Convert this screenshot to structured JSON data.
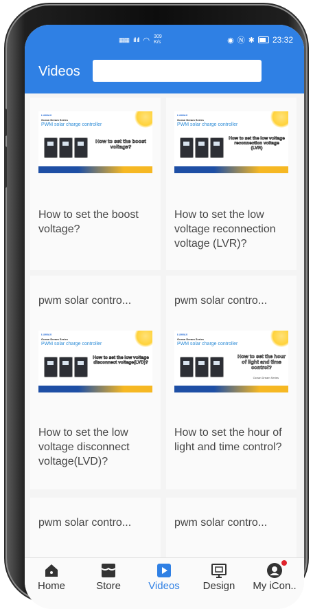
{
  "status_bar": {
    "network_speed": "309",
    "network_unit": "K/s",
    "time": "23:32"
  },
  "header": {
    "title": "Videos",
    "search_placeholder": ""
  },
  "videos": [
    {
      "title": "How to set the boost voltage?",
      "thumb": {
        "brand": "LUMIAX",
        "series": "Ocean Dream Series",
        "product": "PWM solar charge controller",
        "caption": "How to set the boost voltage?"
      }
    },
    {
      "title": "How to set the low voltage reconnection voltage (LVR)?",
      "thumb": {
        "brand": "LUMIAX",
        "series": "Ocean Dream Series",
        "product": "PWM solar charge controller",
        "caption": "How to set the low voltage reconnection voltage (LVR)"
      }
    },
    {
      "title": "How to set the low voltage disconnect voltage(LVD)?",
      "pre_title": "pwm solar contro...",
      "thumb": {
        "brand": "LUMIAX",
        "series": "Ocean Dream Series",
        "product": "PWM solar charge controller",
        "caption": "How to set the low voltage disconnect voltage(LVD)?"
      }
    },
    {
      "title": "How to set the hour of light and time control?",
      "pre_title": "pwm solar contro...",
      "thumb": {
        "brand": "LUMIAX",
        "series": "Ocean Dream Series",
        "product": "PWM solar charge controller",
        "caption": "How to set the hour of light and time control?",
        "footer_series": "Ocean Dream Series"
      }
    },
    {
      "pre_title": "pwm solar contro..."
    },
    {
      "pre_title": "pwm solar contro..."
    }
  ],
  "bottom_nav": [
    {
      "label": "Home",
      "icon": "home-icon",
      "active": false
    },
    {
      "label": "Store",
      "icon": "store-icon",
      "active": false
    },
    {
      "label": "Videos",
      "icon": "play-icon",
      "active": true
    },
    {
      "label": "Design",
      "icon": "design-icon",
      "active": false
    },
    {
      "label": "My iCon..",
      "icon": "person-icon",
      "active": false,
      "badge": true
    }
  ],
  "colors": {
    "brand_blue": "#2f80e4",
    "badge_red": "#e0242c"
  }
}
